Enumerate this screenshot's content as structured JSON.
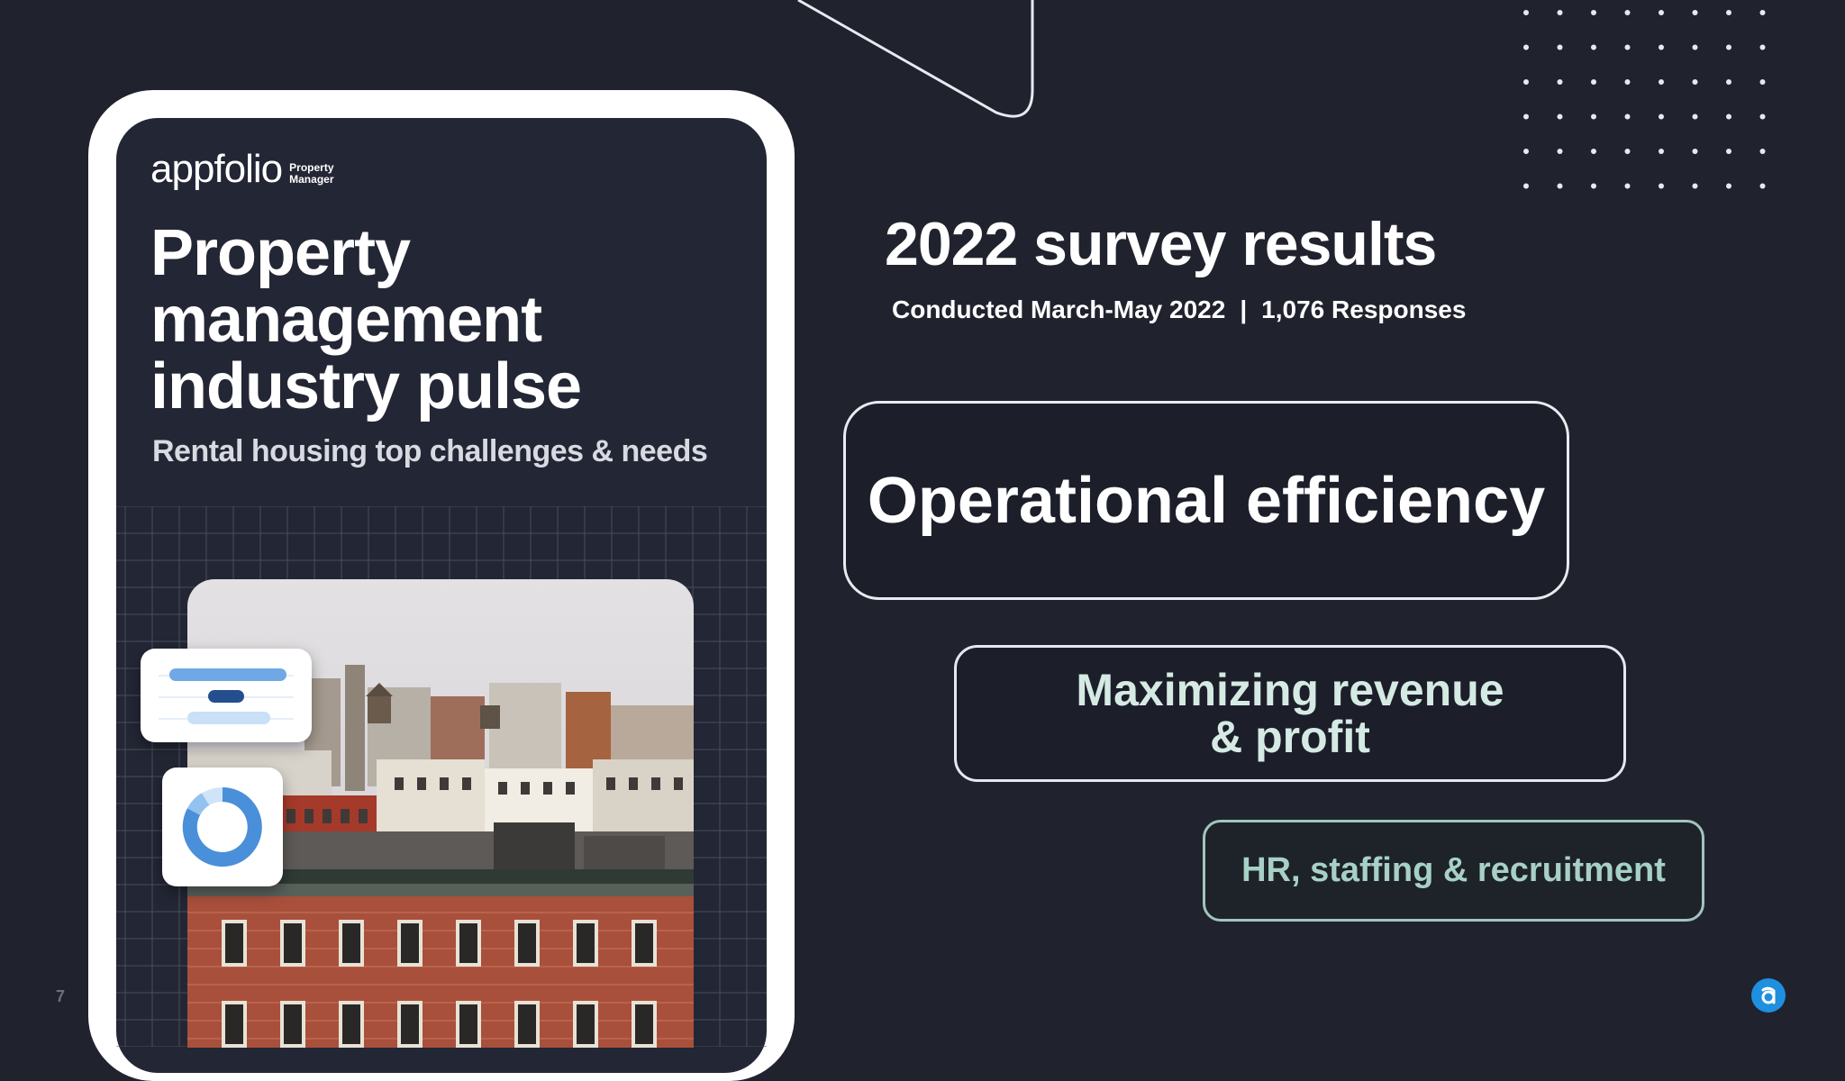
{
  "page": {
    "number": "7"
  },
  "cover": {
    "brand_name": "appfolio",
    "brand_product_line1": "Property",
    "brand_product_line2": "Manager",
    "title": "Property management industry pulse",
    "subtitle": "Rental housing top challenges & needs"
  },
  "survey": {
    "title": "2022 survey results",
    "conducted": "Conducted March-May 2022",
    "separator": "|",
    "responses": "1,076 Responses"
  },
  "challenges": [
    {
      "label": "Operational efficiency"
    },
    {
      "label": "Maximizing revenue & profit"
    },
    {
      "label": "HR, staffing & recruitment"
    }
  ],
  "icons": {
    "corner_logo": "appfolio-logo-icon",
    "donut_widget": "donut-chart-icon",
    "bar_widget": "bar-list-icon"
  },
  "colors": {
    "background": "#20232e",
    "accent_teal": "#a7d0c7",
    "brand_blue": "#1f8fe0"
  }
}
